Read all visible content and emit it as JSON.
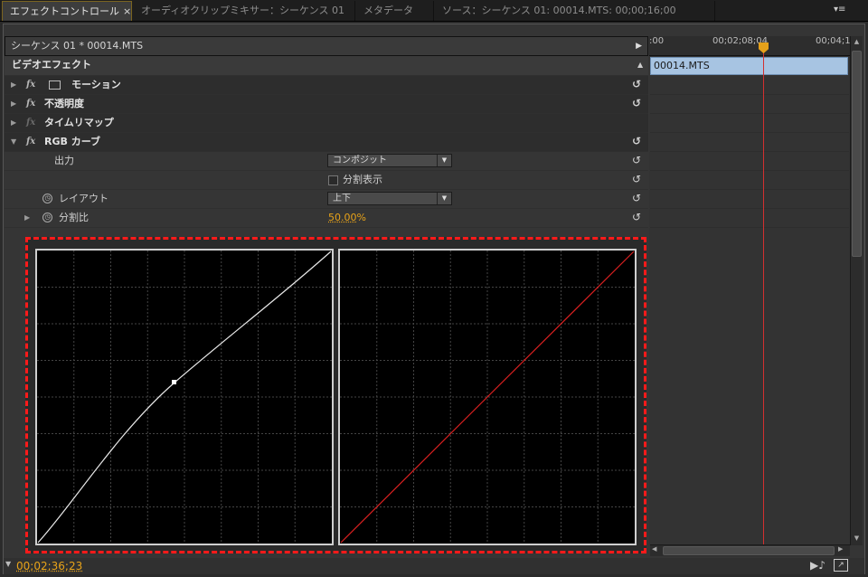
{
  "tabs": [
    {
      "label": "エフェクトコントロール",
      "close": "×"
    },
    {
      "label": "オーディオクリップミキサー：シーケンス 01"
    },
    {
      "label": "メタデータ"
    },
    {
      "label": "ソース：シーケンス 01: 00014.MTS: 00;00;16;00"
    }
  ],
  "panel_menu_icon": "panel-menu-icon",
  "clip_header": "シーケンス 01 * 00014.MTS",
  "section_title": "ビデオエフェクト",
  "effects": {
    "motion": "モーション",
    "opacity": "不透明度",
    "timeremap": "タイムリマップ",
    "rgbcurves": "RGB カーブ"
  },
  "fx_symbol": "fx",
  "params": {
    "output_label": "出力",
    "output_value": "コンポジット",
    "split_label": "分割表示",
    "layout_label": "レイアウト",
    "layout_value": "上下",
    "ratio_label": "分割比",
    "ratio_value": "50.00",
    "ratio_unit": "%"
  },
  "timeline": {
    "ticks": [
      ":00",
      "00;02;08;04",
      "00;04;1"
    ],
    "clip_name": "00014.MTS"
  },
  "footer": {
    "timecode": "00;02;36;23"
  },
  "colors": {
    "accent": "#e8a319",
    "clip": "#a7c4e2",
    "playhead": "#d23030",
    "highlight": "#ff1a1a"
  }
}
